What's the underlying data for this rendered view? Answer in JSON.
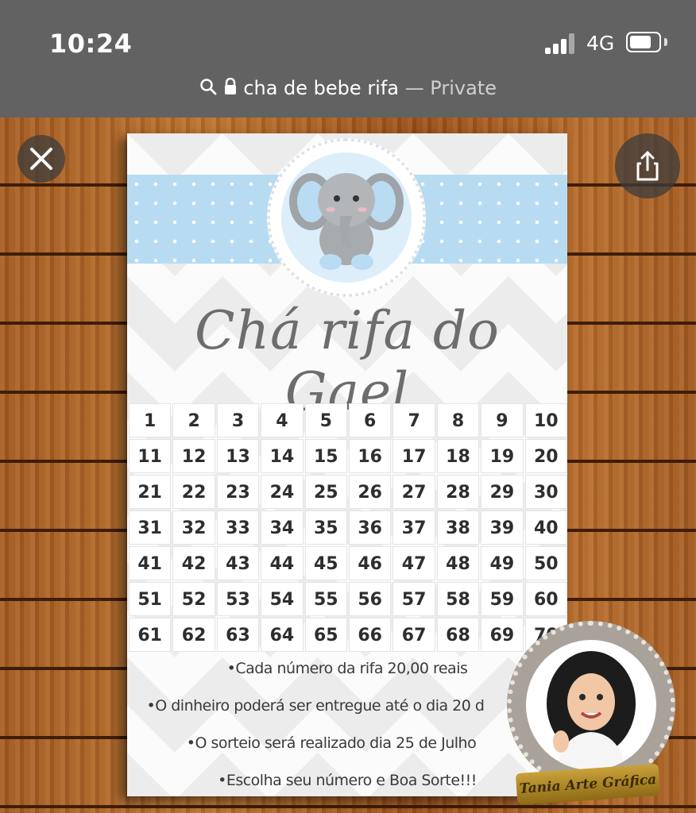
{
  "status_bar": {
    "time": "10:24",
    "network": "4G",
    "battery_level": 0.76
  },
  "url_bar": {
    "search_icon": "search-icon",
    "lock_icon": "lock-icon",
    "query": "cha de bebe rifa",
    "mode": "— Private"
  },
  "viewer": {
    "close_icon": "close-icon",
    "share_icon": "share-icon"
  },
  "card": {
    "title": "Chá rifa do Gael",
    "numbers": [
      1,
      2,
      3,
      4,
      5,
      6,
      7,
      8,
      9,
      10,
      11,
      12,
      13,
      14,
      15,
      16,
      17,
      18,
      19,
      20,
      21,
      22,
      23,
      24,
      25,
      26,
      27,
      28,
      29,
      30,
      31,
      32,
      33,
      34,
      35,
      36,
      37,
      38,
      39,
      40,
      41,
      42,
      43,
      44,
      45,
      46,
      47,
      48,
      49,
      50,
      51,
      52,
      53,
      54,
      55,
      56,
      57,
      58,
      59,
      60,
      61,
      62,
      63,
      64,
      65,
      66,
      67,
      68,
      69,
      70
    ],
    "rules": [
      "•Cada número da rifa 20,00 reais",
      "•O dinheiro poderá ser entregue até o dia 20 d",
      "•O sorteio será realizado dia 25 de Julho",
      "•Escolha seu número e Boa Sorte!!!"
    ]
  },
  "stamp": {
    "text": "Tania Arte Gráfica"
  },
  "colors": {
    "status_bar_bg": "#626262",
    "ribbon_blue": "#b7dcf1",
    "title_gray": "#6d6d6d"
  }
}
